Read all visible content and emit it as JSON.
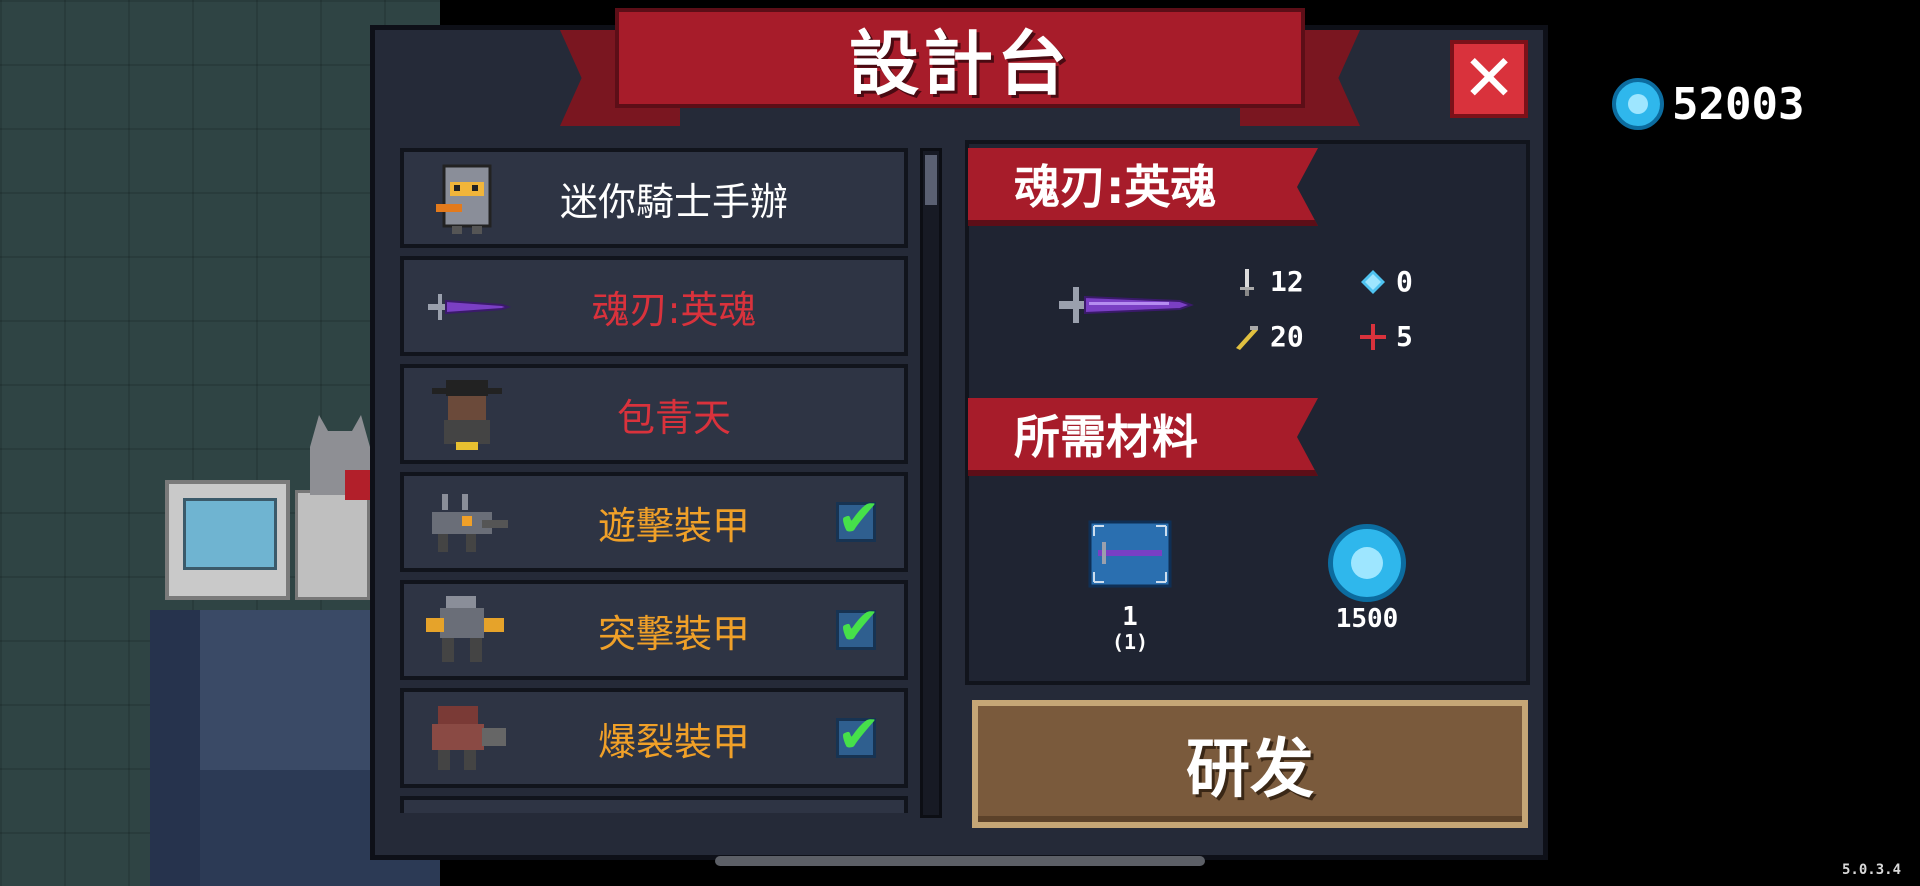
{
  "title": "設計台",
  "close_label": "✕",
  "currency": {
    "icon": "gem-icon",
    "value": "52003",
    "color": "#2fb7ec"
  },
  "list": {
    "items": [
      {
        "label": "迷你騎士手辦",
        "color": "#ffffff",
        "icon": "knight-figure-icon",
        "checked": false
      },
      {
        "label": "魂刃:英魂",
        "color": "#d9323c",
        "icon": "purple-sword-icon",
        "checked": false
      },
      {
        "label": "包青天",
        "color": "#d9323c",
        "icon": "judge-character-icon",
        "checked": false
      },
      {
        "label": "遊擊裝甲",
        "color": "#f0a028",
        "icon": "mech-armor-icon",
        "checked": true
      },
      {
        "label": "突擊裝甲",
        "color": "#f0a028",
        "icon": "assault-mech-icon",
        "checked": true
      },
      {
        "label": "爆裂裝甲",
        "color": "#f0a028",
        "icon": "blast-mech-icon",
        "checked": true
      }
    ]
  },
  "detail": {
    "name": "魂刃:英魂",
    "stats": {
      "damage": "12",
      "energy": "0",
      "crit": "20",
      "accuracy": "5"
    },
    "materials_title": "所需材料",
    "materials": [
      {
        "icon": "blueprint-icon",
        "amount": "1",
        "owned": "(1)"
      },
      {
        "icon": "gem-icon",
        "amount": "1500"
      }
    ]
  },
  "research_label": "研发",
  "version": "5.0.3.4"
}
